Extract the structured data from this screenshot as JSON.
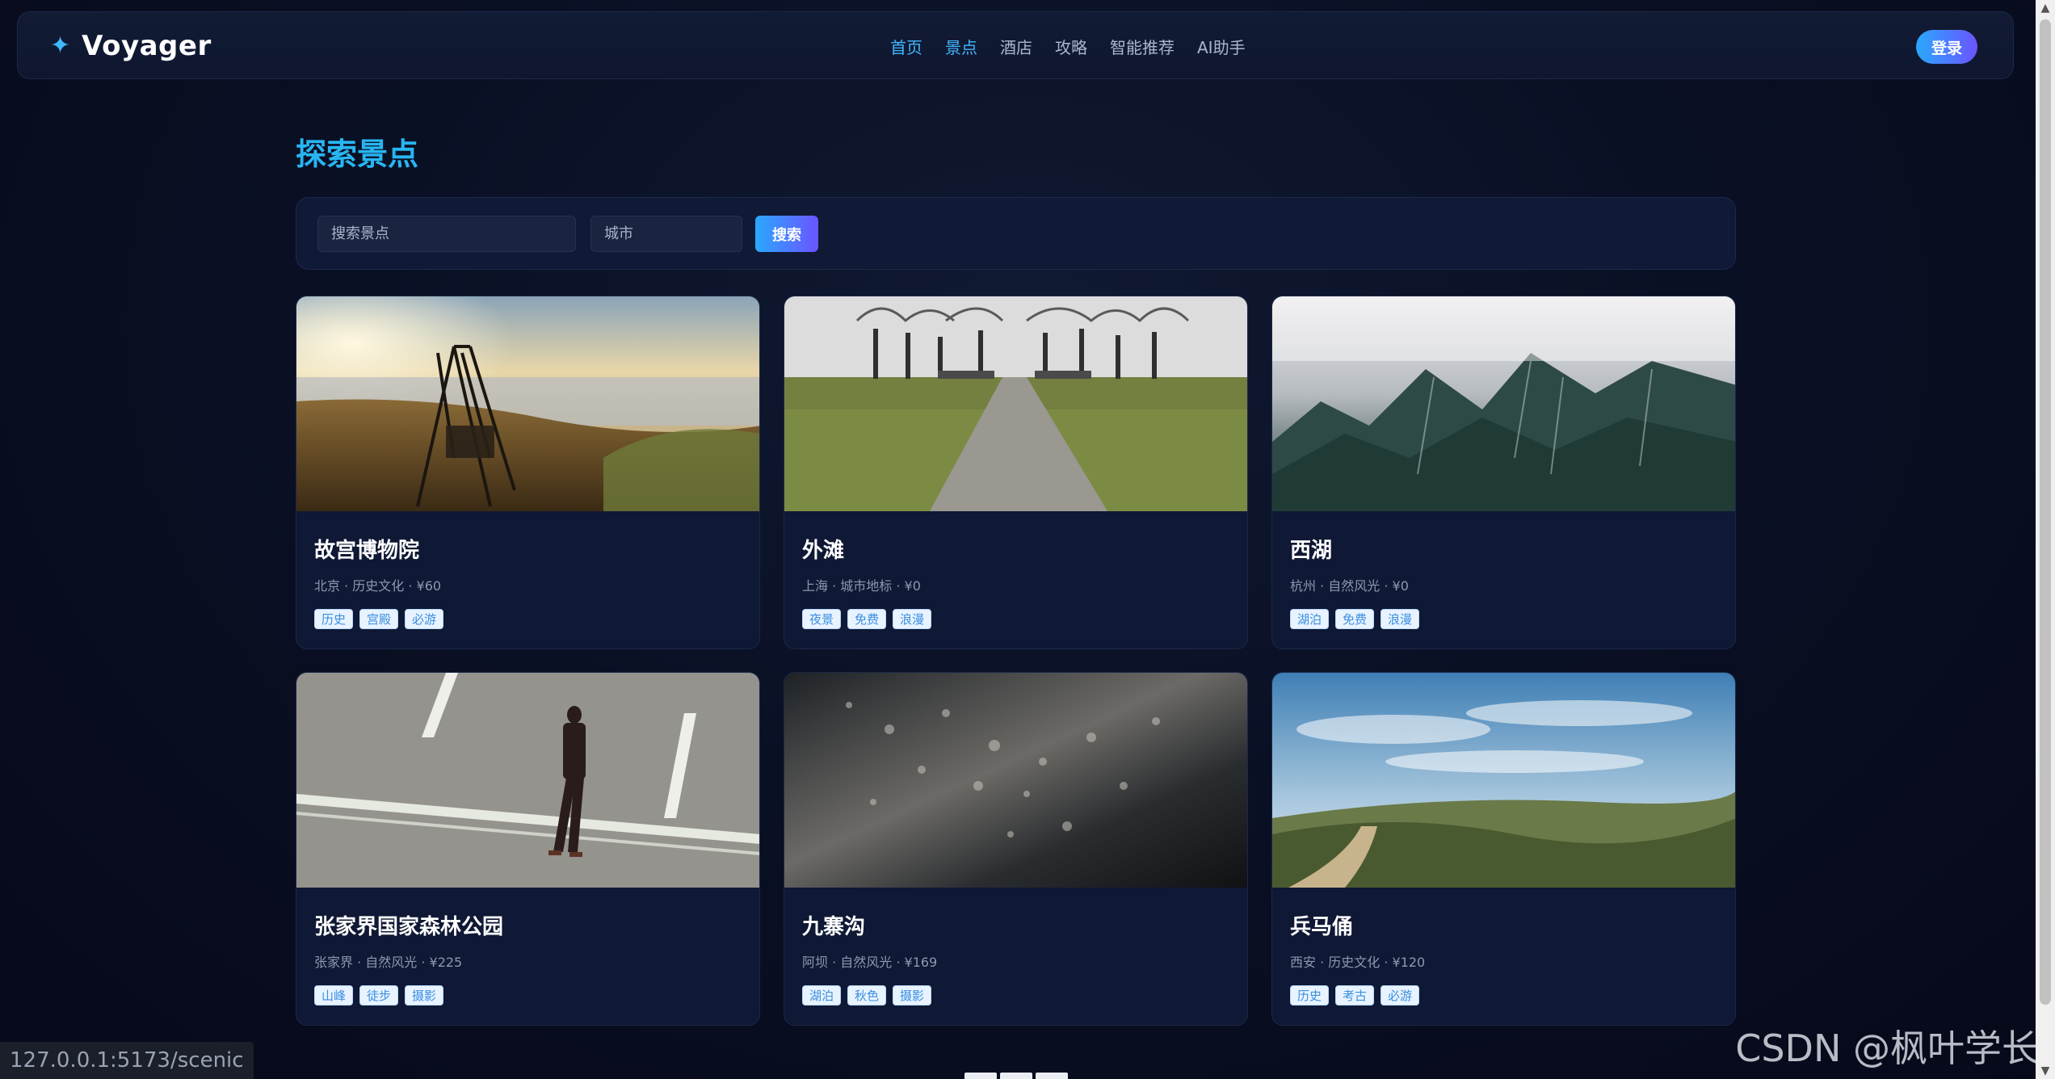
{
  "brand": {
    "icon": "sparkle-icon",
    "name": "Voyager"
  },
  "nav": {
    "items": [
      {
        "label": "首页",
        "active": true
      },
      {
        "label": "景点",
        "active": true
      },
      {
        "label": "酒店",
        "active": false
      },
      {
        "label": "攻略",
        "active": false
      },
      {
        "label": "智能推荐",
        "active": false
      },
      {
        "label": "AI助手",
        "active": false
      }
    ],
    "login_label": "登录"
  },
  "page": {
    "title": "探索景点"
  },
  "search": {
    "keyword_placeholder": "搜索景点",
    "city_placeholder": "城市",
    "button_label": "搜索"
  },
  "spots": [
    {
      "name": "故宫博物院",
      "meta": "北京 · 历史文化 · ¥60",
      "tags": [
        "历史",
        "宫殿",
        "必游"
      ],
      "image": "lakeside-swing-sunset"
    },
    {
      "name": "外滩",
      "meta": "上海 · 城市地标 · ¥0",
      "tags": [
        "夜景",
        "免费",
        "浪漫"
      ],
      "image": "tree-lined-path"
    },
    {
      "name": "西湖",
      "meta": "杭州 · 自然风光 · ¥0",
      "tags": [
        "湖泊",
        "免费",
        "浪漫"
      ],
      "image": "misty-mountains"
    },
    {
      "name": "张家界国家森林公园",
      "meta": "张家界 · 自然风光 · ¥225",
      "tags": [
        "山峰",
        "徒步",
        "摄影"
      ],
      "image": "man-walking-road"
    },
    {
      "name": "九寨沟",
      "meta": "阿坝 · 自然风光 · ¥169",
      "tags": [
        "湖泊",
        "秋色",
        "摄影"
      ],
      "image": "wet-asphalt-drops"
    },
    {
      "name": "兵马俑",
      "meta": "西安 · 历史文化 · ¥120",
      "tags": [
        "历史",
        "考古",
        "必游"
      ],
      "image": "hill-trail-sky"
    }
  ],
  "status_bar": {
    "url": "127.0.0.1:5173/scenic"
  },
  "watermark": "CSDN @枫叶学长",
  "colors": {
    "accent": "#27b6f2",
    "button_start": "#2aa8ff",
    "button_end": "#6b54ff",
    "background": "#0a1024"
  }
}
